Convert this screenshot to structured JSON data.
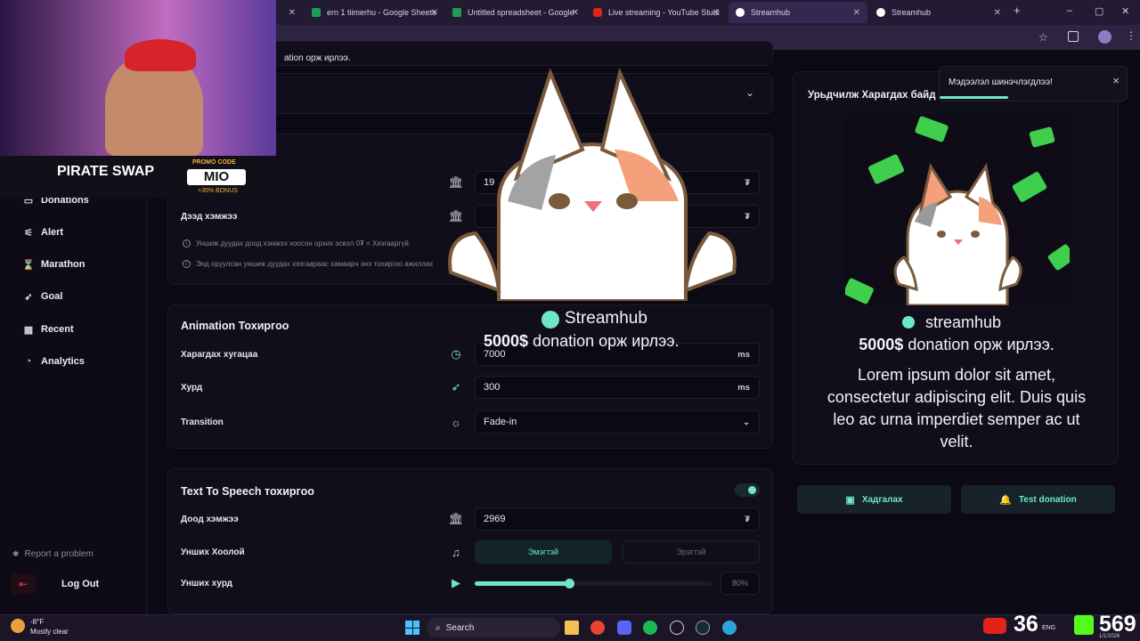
{
  "browser": {
    "tabs": [
      {
        "label": "ern 1 tiimerhu - Google Sheets",
        "color": "#1e9e54"
      },
      {
        "label": "Untitled spreadsheet - Google",
        "color": "#1e9e54"
      },
      {
        "label": "Live streaming - YouTube Studi",
        "color": "#e2231a"
      },
      {
        "label": "Streamhub",
        "color": "#ffffff"
      },
      {
        "label": "Streamhub",
        "color": "#ffffff"
      }
    ],
    "new_tab": "+",
    "window_controls": [
      "–",
      "▢",
      "✕"
    ]
  },
  "webcam": {
    "promo_brand": "PIRATE SWAP",
    "promo_code_label": "PROMO CODE",
    "promo_code": "MIO",
    "promo_bonus": "+35% BONUS"
  },
  "sidebar": {
    "items": [
      {
        "label": "Donations",
        "icon": "money-icon"
      },
      {
        "label": "Alert",
        "icon": "sliders-icon"
      },
      {
        "label": "Marathon",
        "icon": "hourglass-icon"
      },
      {
        "label": "Goal",
        "icon": "rocket-icon"
      },
      {
        "label": "Recent",
        "icon": "calendar-icon"
      },
      {
        "label": "Analytics",
        "icon": "chart-icon"
      }
    ],
    "report": "Report a problem",
    "logout": "Log Out"
  },
  "top_card": {
    "partial_text": "ation орж ирлээ."
  },
  "amount_card": {
    "min_value": "19",
    "max_label": "Дээд хэмжээ",
    "currency": "₮",
    "note1": "Уншиж дуудах доод хэмжээ хоосон орхих эсвэл 0₮ = Хязгааргүй",
    "note2": "Энд оруулсан уншиж дуудах хязгаараас хамаарч энэ тохиргоо ажиллах"
  },
  "animation_card": {
    "title": "Animation Тохиргоо",
    "rows": [
      {
        "label": "Харагдах хугацаа",
        "value": "7000",
        "unit": "ms"
      },
      {
        "label": "Хурд",
        "value": "300",
        "unit": "ms"
      },
      {
        "label": "Transition",
        "value": "Fade-in",
        "unit": "⌄"
      }
    ]
  },
  "tts_card": {
    "title": "Text To Speech тохиргоо",
    "enabled": true,
    "min_label": "Доод хэмжээ",
    "min_value": "2969",
    "currency": "₮",
    "voice_label": "Унших Хоолой",
    "voice_options": [
      "Эмэгтэй",
      "Эрэгтэй"
    ],
    "voice_selected": "Эмэгтэй",
    "speed_label": "Унших хурд",
    "speed_value": "80%",
    "speed_level": 0.8
  },
  "overlay": {
    "brand": "Streamhub",
    "amount": "5000$",
    "message": "donation орж ирлээ."
  },
  "preview": {
    "title": "Урьдчилж Харагдах байд",
    "brand": "streamhub",
    "amount": "5000$",
    "message": "donation орж ирлээ.",
    "body": "Lorem ipsum dolor sit amet, consectetur adipiscing elit. Duis quis leo ac urna imperdiet semper ac ut velit.",
    "save_button": "Хадгалах",
    "test_button": "Test donation"
  },
  "toast": {
    "message": "Мэдээлэл шинэчлэгдлээ!",
    "close": "×"
  },
  "taskbar": {
    "weather_temp": "-8°F",
    "weather_desc": "Mostly clear",
    "search": "Search",
    "lang": "ENG",
    "youtube_count": "36",
    "kick_count": "569",
    "date": "1/1/2026"
  },
  "colors": {
    "accent": "#6ee7c8",
    "background": "#0b0913",
    "card": "#110e1b"
  }
}
